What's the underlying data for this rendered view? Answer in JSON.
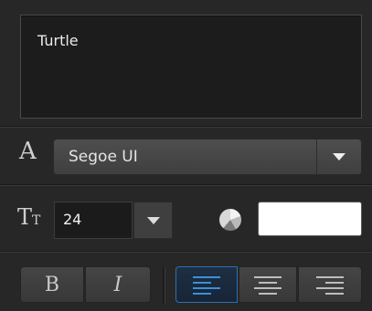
{
  "text_input": {
    "value": "Turtle"
  },
  "font": {
    "icon": "A",
    "family": "Segoe UI"
  },
  "size": {
    "icon_big": "T",
    "icon_small": "T",
    "value": "24"
  },
  "color": {
    "value": "#ffffff",
    "accent": "#2f6fae"
  },
  "style_buttons": {
    "bold": "B",
    "italic": "I"
  },
  "alignment": {
    "selected": "left",
    "options": [
      "left",
      "center",
      "right"
    ]
  }
}
